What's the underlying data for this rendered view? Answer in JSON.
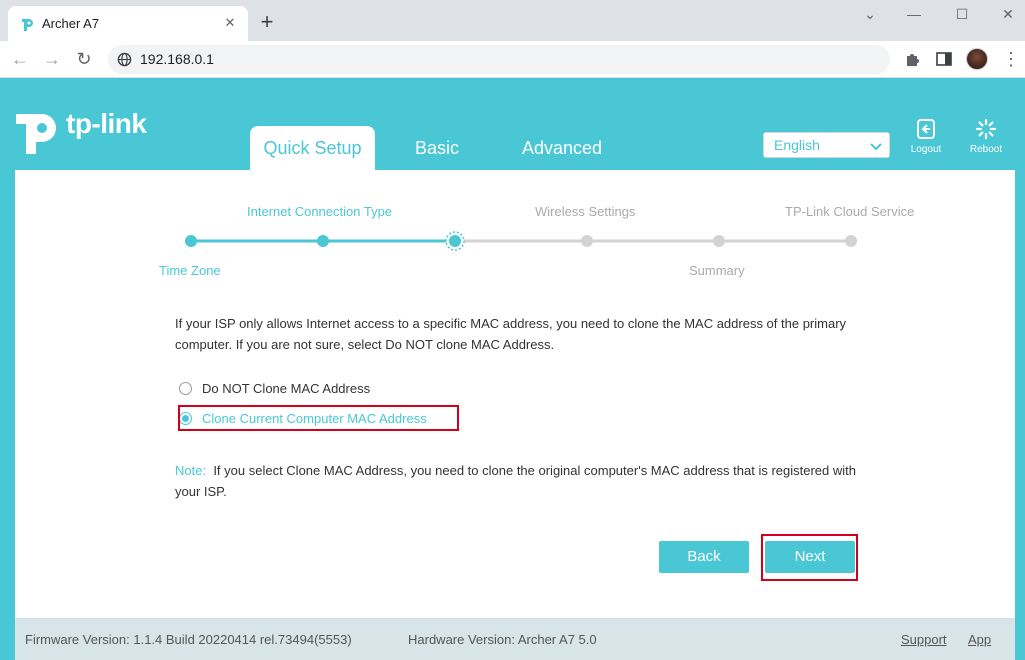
{
  "browser": {
    "tab_title": "Archer A7",
    "url": "192.168.0.1"
  },
  "router": {
    "brand": "tp-link",
    "nav_tabs": [
      {
        "label": "Quick Setup",
        "active": true
      },
      {
        "label": "Basic",
        "active": false
      },
      {
        "label": "Advanced",
        "active": false
      }
    ],
    "language": "English",
    "logout_label": "Logout",
    "reboot_label": "Reboot"
  },
  "wizard": {
    "steps": [
      {
        "label": "Time Zone",
        "status": "done"
      },
      {
        "label": "Internet Connection Type",
        "status": "done"
      },
      {
        "label": "",
        "status": "current"
      },
      {
        "label": "Wireless Settings",
        "status": "pending"
      },
      {
        "label": "Summary",
        "status": "pending"
      },
      {
        "label": "TP-Link Cloud Service",
        "status": "pending"
      }
    ],
    "intro_text": "If your ISP only allows Internet access to a specific MAC address, you need to clone the MAC address of the primary computer. If you are not sure, select Do NOT clone MAC Address.",
    "options": [
      {
        "label": "Do NOT Clone MAC Address",
        "selected": false
      },
      {
        "label": "Clone Current Computer MAC Address",
        "selected": true
      }
    ],
    "note_label": "Note:",
    "note_text": "If you select Clone MAC Address, you need to clone the original computer's MAC address that is registered with your ISP.",
    "back_label": "Back",
    "next_label": "Next"
  },
  "footer": {
    "firmware": "Firmware Version: 1.1.4 Build 20220414 rel.73494(5553)",
    "hardware": "Hardware Version: Archer A7 5.0",
    "support": "Support",
    "app": "App"
  },
  "colors": {
    "brand_teal": "#4ac7d5",
    "highlight_red": "#d0021b",
    "footer_bg": "#d7e5e8"
  }
}
